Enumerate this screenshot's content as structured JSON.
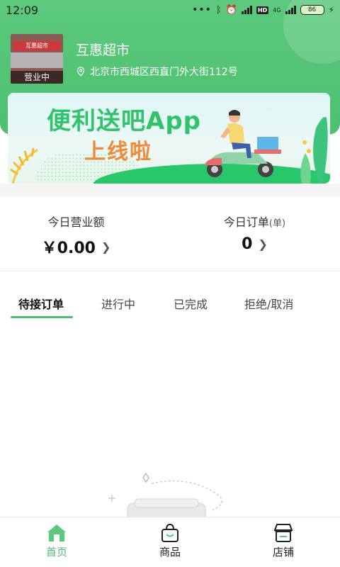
{
  "status_bar": {
    "time": "12:09",
    "network": "4G",
    "hd": "HD",
    "battery": "86"
  },
  "store": {
    "photo_sign": "互惠超市",
    "status": "营业中",
    "name": "互惠超市",
    "address": "北京市西城区西直门外大街112号"
  },
  "banner": {
    "line1": "便利送吧App",
    "line2": "上线啦"
  },
  "stats": {
    "revenue_label": "今日营业额",
    "revenue_value": "￥0.00",
    "orders_label": "今日订单",
    "orders_unit": "(单)",
    "orders_value": "0"
  },
  "tabs": [
    {
      "label": "待接订单",
      "active": true
    },
    {
      "label": "进行中"
    },
    {
      "label": "已完成"
    },
    {
      "label": "拒绝/取消"
    }
  ],
  "bottom_nav": [
    {
      "label": "首页",
      "icon": "home-icon",
      "active": true
    },
    {
      "label": "商品",
      "icon": "shopping-bag-icon"
    },
    {
      "label": "店铺",
      "icon": "store-icon"
    }
  ],
  "colors": {
    "brand_green": "#4cbf6d",
    "banner_title": "#2fc36a",
    "banner_subtitle": "#f08a3b"
  }
}
